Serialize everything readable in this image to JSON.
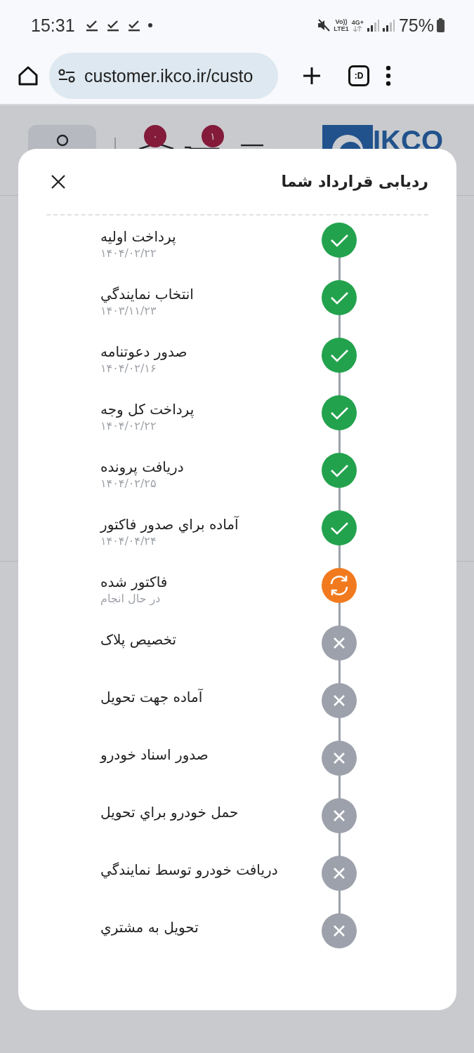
{
  "status_bar": {
    "time": "15:31",
    "network_top": "Vo))",
    "network_bottom": "LTE1",
    "data_type": "4G+",
    "battery": "75%"
  },
  "browser": {
    "url": "customer.ikco.ir/custo",
    "tabs_label": ":D"
  },
  "site_header": {
    "logo": "IKCO",
    "cart_badge": "۱",
    "bag_badge": "۰"
  },
  "modal": {
    "title": "ردیابی قرارداد شما",
    "steps": [
      {
        "label": "پرداخت اولیه",
        "sub": "۱۴۰۴/۰۲/۲۲",
        "kind": "done"
      },
      {
        "label": "انتخاب نمايندگي",
        "sub": "۱۴۰۳/۱۱/۲۳",
        "kind": "done"
      },
      {
        "label": "صدور دعوتنامه",
        "sub": "۱۴۰۴/۰۲/۱۶",
        "kind": "done"
      },
      {
        "label": "پرداخت کل وجه",
        "sub": "۱۴۰۴/۰۲/۲۲",
        "kind": "done"
      },
      {
        "label": "دریافت پرونده",
        "sub": "۱۴۰۴/۰۲/۲۵",
        "kind": "done"
      },
      {
        "label": "آماده براي صدور فاکتور",
        "sub": "۱۴۰۴/۰۴/۲۴",
        "kind": "done"
      },
      {
        "label": "فاکتور شده",
        "sub": "در حال انجام",
        "kind": "progress"
      },
      {
        "label": "تخصیص پلاک",
        "kind": "pending"
      },
      {
        "label": "آماده جهت تحویل",
        "kind": "pending"
      },
      {
        "label": "صدور اسناد خودرو",
        "kind": "pending"
      },
      {
        "label": "حمل خودرو براي تحویل",
        "kind": "pending"
      },
      {
        "label": "دریافت خودرو توسط نمايندگي",
        "kind": "pending"
      },
      {
        "label": "تحویل به مشتري",
        "kind": "pending"
      }
    ]
  }
}
